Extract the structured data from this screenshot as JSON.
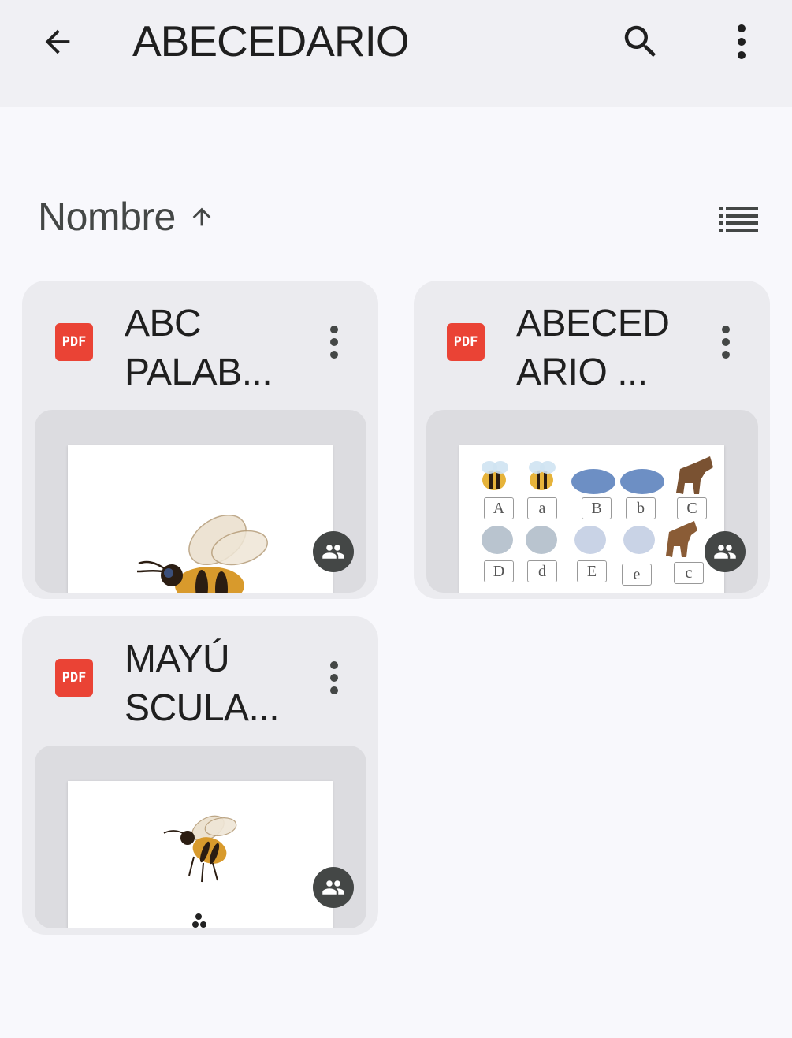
{
  "header": {
    "title": "ABECEDARIO",
    "back_icon": "arrow-back-icon",
    "search_icon": "search-icon",
    "more_icon": "more-vert-icon"
  },
  "sort": {
    "label": "Nombre",
    "direction_icon": "arrow-up-icon",
    "view_icon": "list-view-icon"
  },
  "files": [
    {
      "title": "ABC\nPALAB...",
      "type_badge": "PDF",
      "thumbnail": "bee",
      "shared": true
    },
    {
      "title": "ABECED\nARIO ...",
      "type_badge": "PDF",
      "thumbnail": "alphabet-animals",
      "shared": true,
      "thumb_letters": [
        "A",
        "a",
        "B",
        "b",
        "C",
        "D",
        "d",
        "E",
        "e",
        "c"
      ]
    },
    {
      "title": "MAYÚ\nSCULA...",
      "type_badge": "PDF",
      "thumbnail": "bee",
      "shared": true
    }
  ],
  "colors": {
    "pdf_red": "#ea4335",
    "card_bg": "#ebebef",
    "badge_bg": "#444746"
  }
}
